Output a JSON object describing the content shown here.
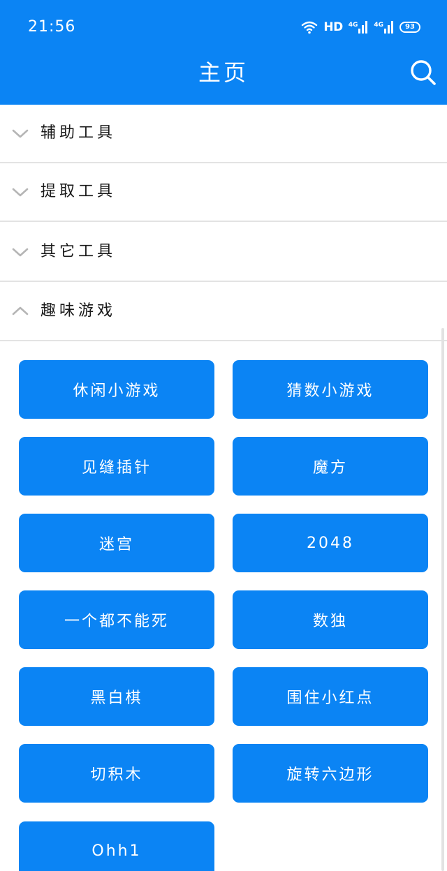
{
  "status_bar": {
    "time": "21:56",
    "hd_label": "HD",
    "network_1": "4G",
    "network_2": "4G",
    "battery": "93"
  },
  "header": {
    "title": "主页",
    "search_icon": "search-icon"
  },
  "sections": [
    {
      "label": "辅助工具",
      "expanded": false
    },
    {
      "label": "提取工具",
      "expanded": false
    },
    {
      "label": "其它工具",
      "expanded": false
    },
    {
      "label": "趣味游戏",
      "expanded": true
    }
  ],
  "games": [
    "休闲小游戏",
    "猜数小游戏",
    "见缝插针",
    "魔方",
    "迷宫",
    "2048",
    "一个都不能死",
    "数独",
    "黑白棋",
    "围住小红点",
    "切积木",
    "旋转六边形",
    "Ohh1"
  ],
  "colors": {
    "brand": "#0b84f4",
    "divider": "#e3e3e3",
    "chevron": "#b5b5b5"
  }
}
